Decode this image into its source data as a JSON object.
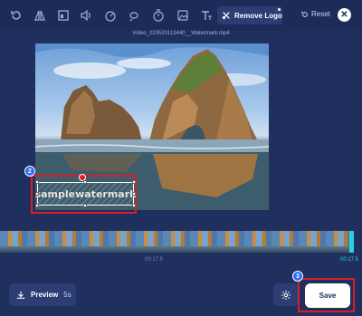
{
  "toolbar": {
    "tools": [
      "rotate-icon",
      "flip-icon",
      "crop-icon",
      "volume-icon",
      "speed-icon",
      "loop-icon",
      "timer-icon",
      "image-icon",
      "text-icon"
    ],
    "remove_logo_label": "Remove Logo",
    "reset_label": "Reset"
  },
  "file": {
    "name": "Video_220520113440__Watermark.mp4"
  },
  "preview": {
    "watermark_text": "samplewatermark"
  },
  "annotations": {
    "step_watermark": "2",
    "step_save": "3"
  },
  "timeline": {
    "current_time": "00:17.5",
    "end_time": "00:17.5"
  },
  "footer": {
    "preview_label": "Preview",
    "preview_duration": "5s",
    "save_label": "Save"
  },
  "colors": {
    "background": "#1f2f5e",
    "toolbar": "#1c2b58",
    "accent": "#2d6cf5",
    "highlight": "#d91f26",
    "timeline_marker": "#2ad1d6"
  }
}
